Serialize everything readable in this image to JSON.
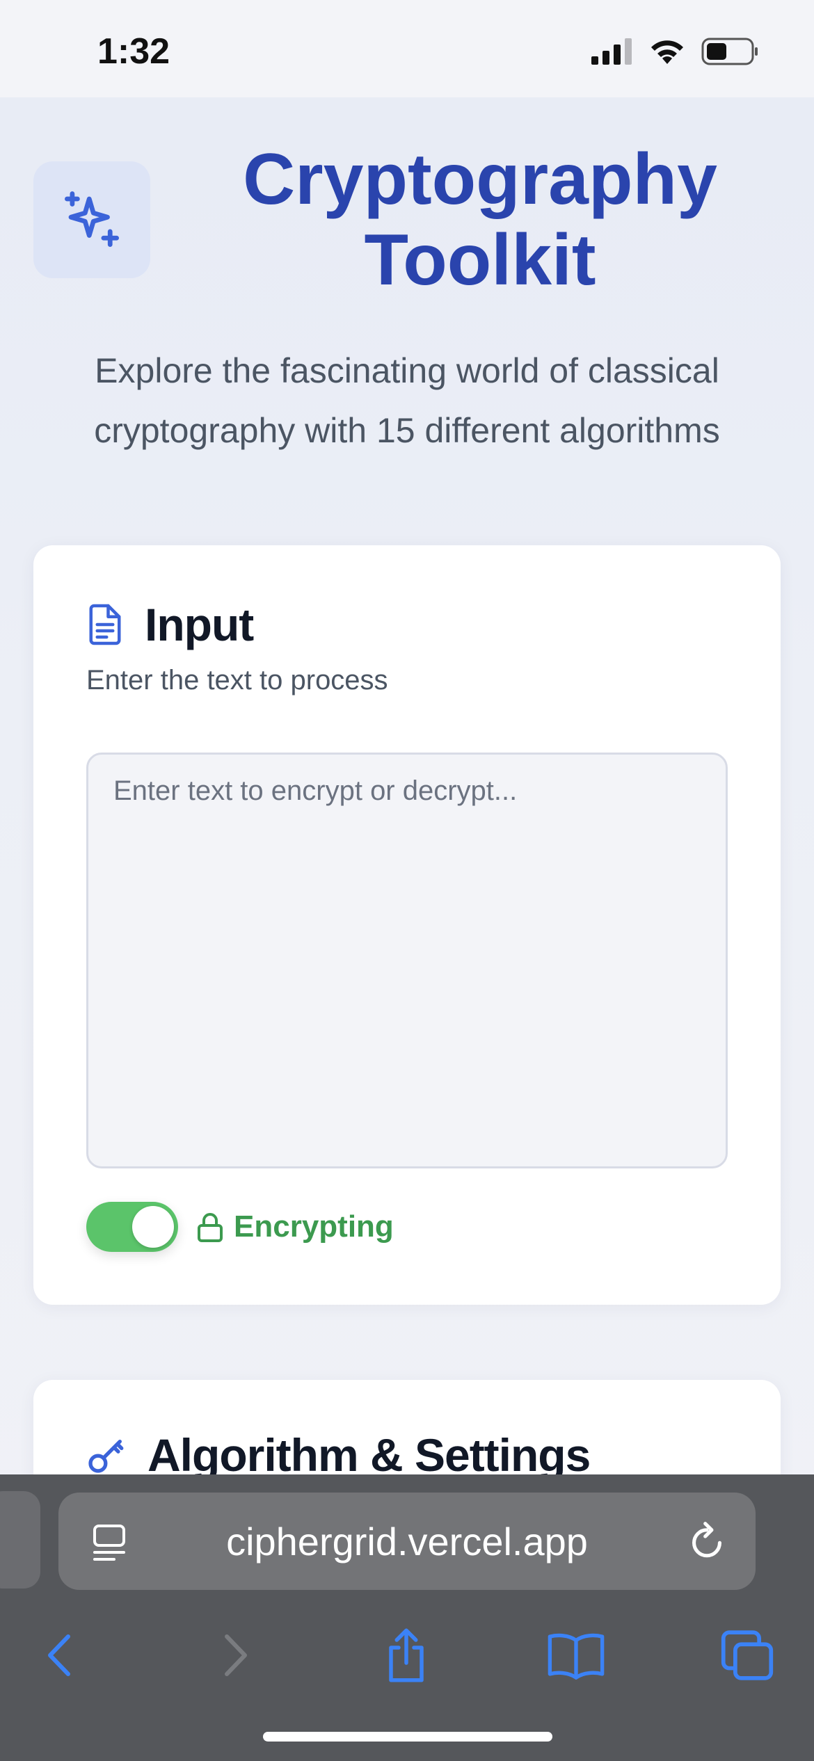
{
  "status_bar": {
    "time": "1:32",
    "icons": [
      "cellular-signal-icon",
      "wifi-icon",
      "battery-icon"
    ]
  },
  "header": {
    "logo_icon": "sparkles-icon",
    "title_line1": "Cryptography",
    "title_line2": "Toolkit",
    "subtitle_line1": "Explore the fascinating world of classical",
    "subtitle_line2": "cryptography with 15 different algorithms"
  },
  "input_card": {
    "icon": "document-icon",
    "title": "Input",
    "description": "Enter the text to process",
    "textarea_placeholder": "Enter text to encrypt or decrypt...",
    "textarea_value": "",
    "toggle_on": true,
    "mode_icon": "lock-icon",
    "mode_label": "Encrypting"
  },
  "settings_card": {
    "icon": "key-icon",
    "title": "Algorithm & Settings"
  },
  "browser": {
    "url": "ciphergrid.vercel.app",
    "toolbar_icons": [
      "back-icon",
      "forward-icon",
      "share-icon",
      "bookmarks-icon",
      "tabs-icon"
    ]
  },
  "colors": {
    "accent": "#2a44ad",
    "icon_blue": "#3b63d9",
    "success_green": "#3c9a4f",
    "toggle_green": "#5bc46a"
  }
}
